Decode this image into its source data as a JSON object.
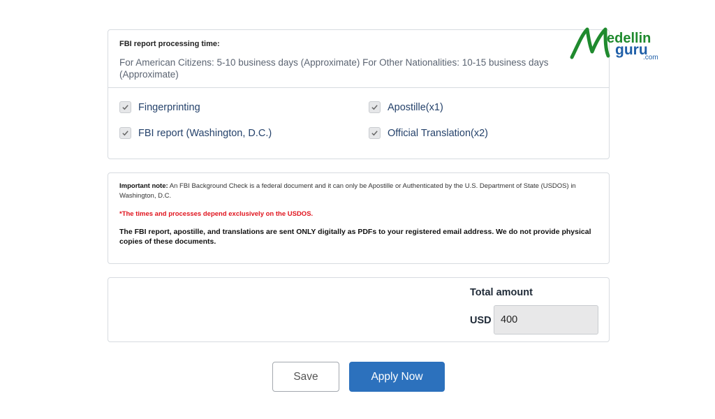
{
  "processing": {
    "title": "FBI report processing time:",
    "text": "For American Citizens: 5-10 business days (Approximate) For Other Nationalities: 10-15 business days (Approximate)"
  },
  "services": [
    {
      "label": "Fingerprinting",
      "checked": true
    },
    {
      "label": "Apostille(x1)",
      "checked": true
    },
    {
      "label": "FBI report (Washington, D.C.)",
      "checked": true
    },
    {
      "label": "Official Translation(x2)",
      "checked": true
    }
  ],
  "notes": {
    "important_label": "Important note:",
    "important_text": " An FBI Background Check is a federal document and it can only be Apostille or Authenticated by the U.S. Department of State (USDOS) in Washington, D.C.",
    "warning": "*The times and processes depend exclusively on the USDOS.",
    "delivery": "The FBI report, apostille, and translations are sent ONLY digitally as PDFs to your registered email address. We do not provide physical copies of these documents."
  },
  "total": {
    "label": "Total amount",
    "currency": "USD",
    "amount": "400"
  },
  "buttons": {
    "save": "Save",
    "apply": "Apply Now"
  },
  "logo": {
    "part1": "edellin",
    "part2": "guru",
    "part3": ".com"
  },
  "colors": {
    "accent": "#2c71bd",
    "warning": "#e0141e",
    "logo_green": "#1f8a2e",
    "logo_blue": "#1f5fa8"
  }
}
